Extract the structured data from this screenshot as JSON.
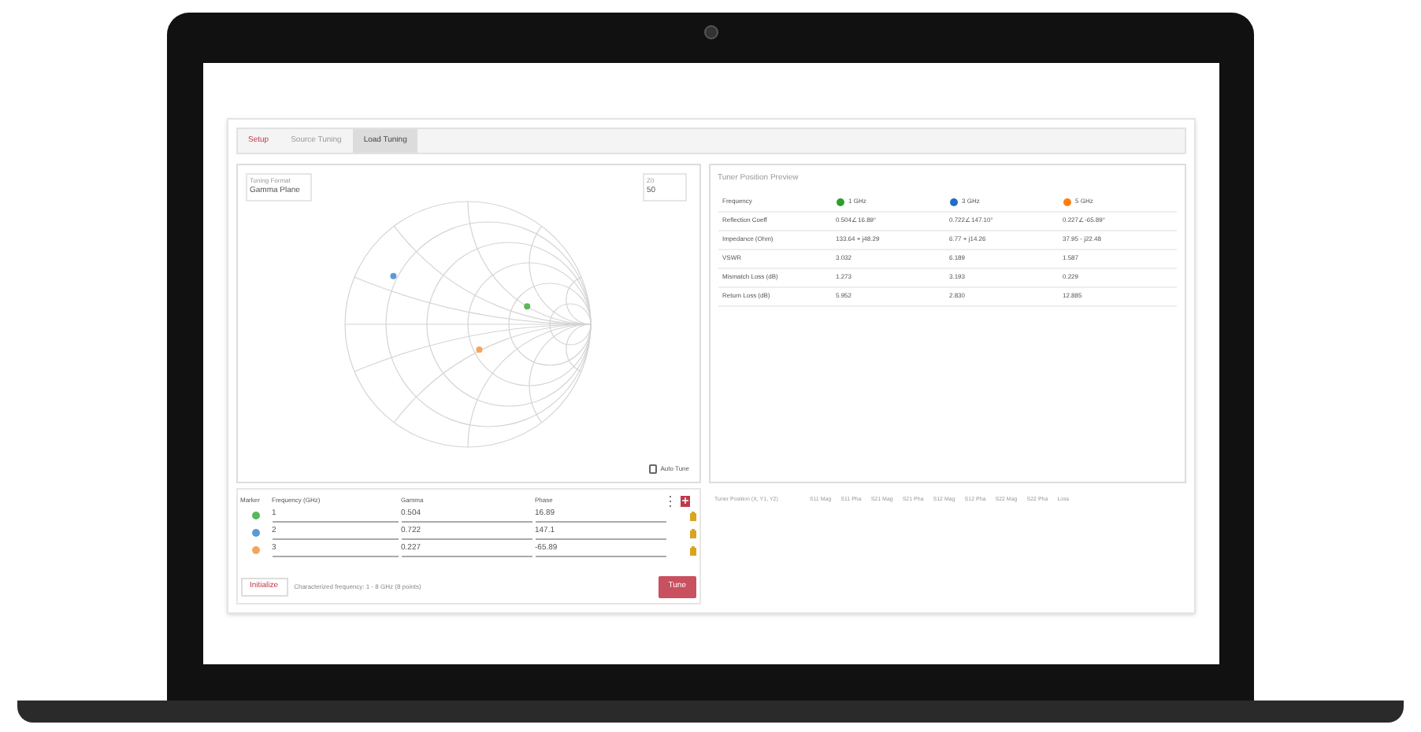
{
  "tabs": [
    {
      "label": "Setup",
      "selected": false,
      "kind": "accent"
    },
    {
      "label": "Source Tuning",
      "selected": false,
      "kind": "plain"
    },
    {
      "label": "Load Tuning",
      "selected": true,
      "kind": "plain"
    }
  ],
  "tuning_format": {
    "label": "Tuning Format",
    "value": "Gamma Plane"
  },
  "z0": {
    "label": "Z0",
    "value": "50"
  },
  "auto_tune": {
    "label": "Auto Tune",
    "checked": false
  },
  "markers": {
    "columns": [
      "Marker",
      "Frequency (GHz)",
      "Gamma",
      "Phase"
    ],
    "rows": [
      {
        "color": "#5cb85c",
        "frequency": "1",
        "gamma": "0.504",
        "phase": "16.89"
      },
      {
        "color": "#5b9bd5",
        "frequency": "2",
        "gamma": "0.722",
        "phase": "147.1"
      },
      {
        "color": "#f5a55a",
        "frequency": "3",
        "gamma": "0.227",
        "phase": "-65.89"
      }
    ]
  },
  "initialize_button": "Initialize",
  "characterized_note": "Characterized frequency: 1 - 8 GHz (8 points)",
  "tune_button": "Tune",
  "preview": {
    "title": "Tuner Position Preview",
    "header": {
      "label": "Frequency",
      "columns": [
        {
          "color": "#2ca02c",
          "label": "1 GHz"
        },
        {
          "color": "#1f6fc5",
          "label": "3 GHz"
        },
        {
          "color": "#ff7f0e",
          "label": "5 GHz"
        }
      ]
    },
    "rows": [
      {
        "label": "Reflection Coeff",
        "values": [
          "0.504∠16.89°",
          "0.722∠147.10°",
          "0.227∠-65.89°"
        ]
      },
      {
        "label": "Impedance (Ohm)",
        "values": [
          "133.64 + j48.29",
          "6.77 + j14.26",
          "37.95 - j22.48"
        ]
      },
      {
        "label": "VSWR",
        "values": [
          "3.032",
          "6.189",
          "1.587"
        ]
      },
      {
        "label": "Mismatch Loss (dB)",
        "values": [
          "1.273",
          "3.193",
          "0.229"
        ]
      },
      {
        "label": "Return Loss (dB)",
        "values": [
          "5.952",
          "2.830",
          "12.885"
        ]
      }
    ]
  },
  "sparams_columns": [
    "Tuner Position (X, Y1, Y2)",
    "S11 Mag",
    "S11 Pha",
    "S21 Mag",
    "S21 Pha",
    "S12 Mag",
    "S12 Pha",
    "S22 Mag",
    "S22 Pha",
    "Loss"
  ]
}
